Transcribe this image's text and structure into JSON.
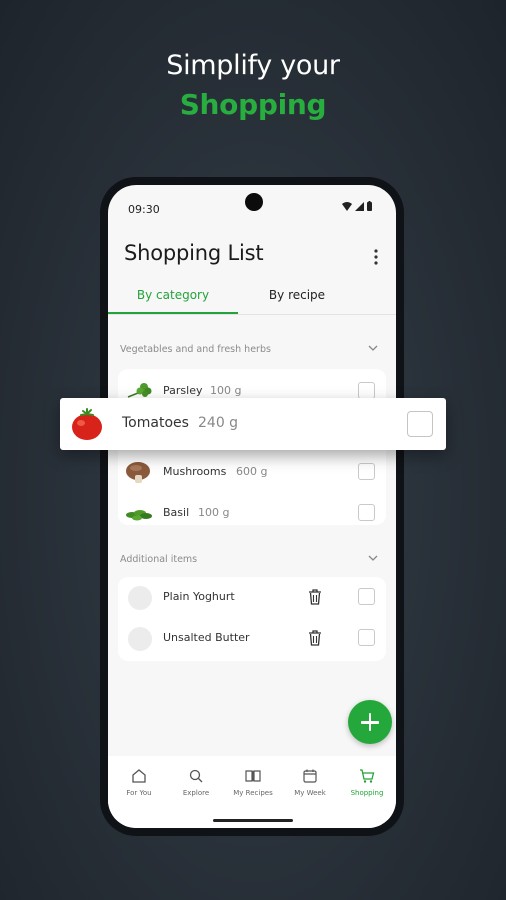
{
  "headline": {
    "line1": "Simplify your",
    "line2": "Shopping"
  },
  "status_bar": {
    "time": "09:30"
  },
  "app": {
    "title": "Shopping List"
  },
  "tabs": [
    {
      "label": "By category",
      "active": true
    },
    {
      "label": "By recipe",
      "active": false
    }
  ],
  "sections": [
    {
      "title": "Vegetables and and fresh herbs",
      "items": [
        {
          "name": "Parsley",
          "quantity": "100 g",
          "icon": "parsley-icon",
          "checked": false
        },
        {
          "name": "Tomatoes",
          "quantity": "240 g",
          "icon": "tomato-icon",
          "checked": false
        },
        {
          "name": "Mushrooms",
          "quantity": "600 g",
          "icon": "mushroom-icon",
          "checked": false
        },
        {
          "name": "Basil",
          "quantity": "100 g",
          "icon": "basil-icon",
          "checked": false
        }
      ]
    },
    {
      "title": "Additional items",
      "items": [
        {
          "name": "Plain Yoghurt",
          "icon": "placeholder-icon",
          "checked": false
        },
        {
          "name": "Unsalted Butter",
          "icon": "placeholder-icon",
          "checked": false
        }
      ]
    }
  ],
  "bottom_nav": [
    {
      "label": "For You",
      "icon": "home-icon",
      "active": false
    },
    {
      "label": "Explore",
      "icon": "search-icon",
      "active": false
    },
    {
      "label": "My Recipes",
      "icon": "book-icon",
      "active": false
    },
    {
      "label": "My Week",
      "icon": "calendar-icon",
      "active": false
    },
    {
      "label": "Shopping",
      "icon": "cart-icon",
      "active": true
    }
  ],
  "colors": {
    "accent": "#23a43a",
    "headline_green": "#27ae3f",
    "background": "#2a323b"
  }
}
